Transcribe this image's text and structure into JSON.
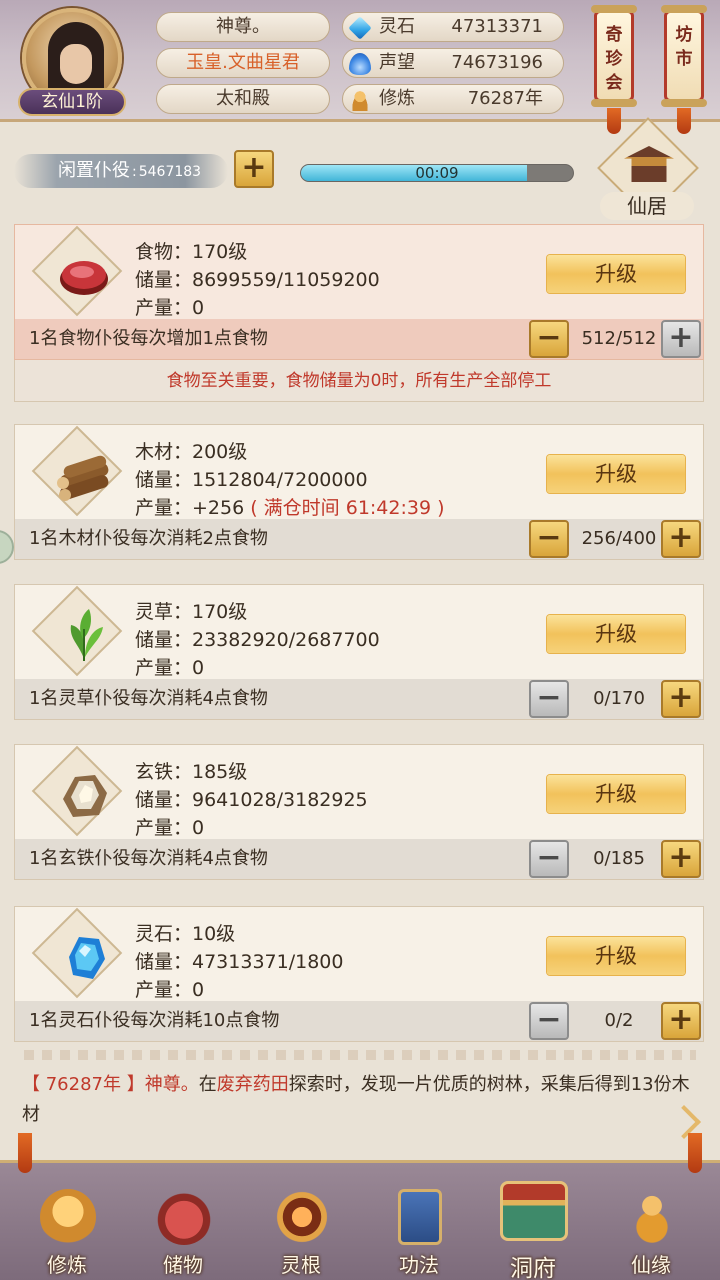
{
  "player": {
    "name": "神尊。",
    "title": "玉皇.文曲星君",
    "location": "太和殿",
    "rank": "玄仙1阶"
  },
  "resources": [
    {
      "icon": "spirit-stone-icon",
      "label": "灵石",
      "value": "47313371"
    },
    {
      "icon": "prestige-icon",
      "label": "声望",
      "value": "74673196"
    },
    {
      "icon": "cultivation-icon",
      "label": "修炼",
      "value": "76287年"
    }
  ],
  "top_buttons": {
    "treasure": "奇珍会",
    "market": "坊市"
  },
  "idle": {
    "label": "闲置仆役",
    "separator": ":",
    "count": "5467183",
    "timer": "00:09",
    "timer_progress": 0.83
  },
  "residence_label": "仙居",
  "upgrade_label": "升级",
  "cards": [
    {
      "key": "food",
      "name_line": "食物：170级",
      "storage_line": "储量：8699559/11059200",
      "output_line": "产量：0",
      "output_extra": "",
      "desc": "1名食物仆役每次增加1点食物",
      "qty": "512/512",
      "minus_disabled": false,
      "plus_disabled": true
    },
    {
      "key": "wood",
      "name_line": "木材：200级",
      "storage_line": "储量：1512804/7200000",
      "output_line": "产量：+256",
      "output_extra": "( 满仓时间 61:42:39 )",
      "desc": "1名木材仆役每次消耗2点食物",
      "qty": "256/400",
      "minus_disabled": false,
      "plus_disabled": false
    },
    {
      "key": "herb",
      "name_line": "灵草：170级",
      "storage_line": "储量：23382920/2687700",
      "output_line": "产量：0",
      "output_extra": "",
      "desc": "1名灵草仆役每次消耗4点食物",
      "qty": "0/170",
      "minus_disabled": true,
      "plus_disabled": false
    },
    {
      "key": "iron",
      "name_line": "玄铁：185级",
      "storage_line": "储量：9641028/3182925",
      "output_line": "产量：0",
      "output_extra": "",
      "desc": "1名玄铁仆役每次消耗4点食物",
      "qty": "0/185",
      "minus_disabled": true,
      "plus_disabled": false
    },
    {
      "key": "stone",
      "name_line": "灵石：10级",
      "storage_line": "储量：47313371/1800",
      "output_line": "产量：0",
      "output_extra": "",
      "desc": "1名灵石仆役每次消耗10点食物",
      "qty": "0/2",
      "minus_disabled": true,
      "plus_disabled": false
    }
  ],
  "food_warning": "食物至关重要，食物储量为0时，所有生产全部停工",
  "log": {
    "year": "【 76287年 】",
    "name": "神尊。",
    "text1": "在",
    "place": "废弃药田",
    "text2": "探索时，发现一片优质的树林，采集后得到13份木材"
  },
  "nav": [
    {
      "label": "修炼",
      "icon": "cultivate-icon"
    },
    {
      "label": "储物",
      "icon": "storage-bag-icon"
    },
    {
      "label": "灵根",
      "icon": "spirit-root-icon"
    },
    {
      "label": "功法",
      "icon": "scripture-icon"
    },
    {
      "label": "洞府",
      "icon": "cave-dwelling-icon",
      "active": true
    },
    {
      "label": "仙缘",
      "icon": "gourd-icon"
    }
  ],
  "colors": {
    "accent_gold": "#f2c25b",
    "warning_red": "#c0392b",
    "timer_cyan": "#41b5d8"
  }
}
